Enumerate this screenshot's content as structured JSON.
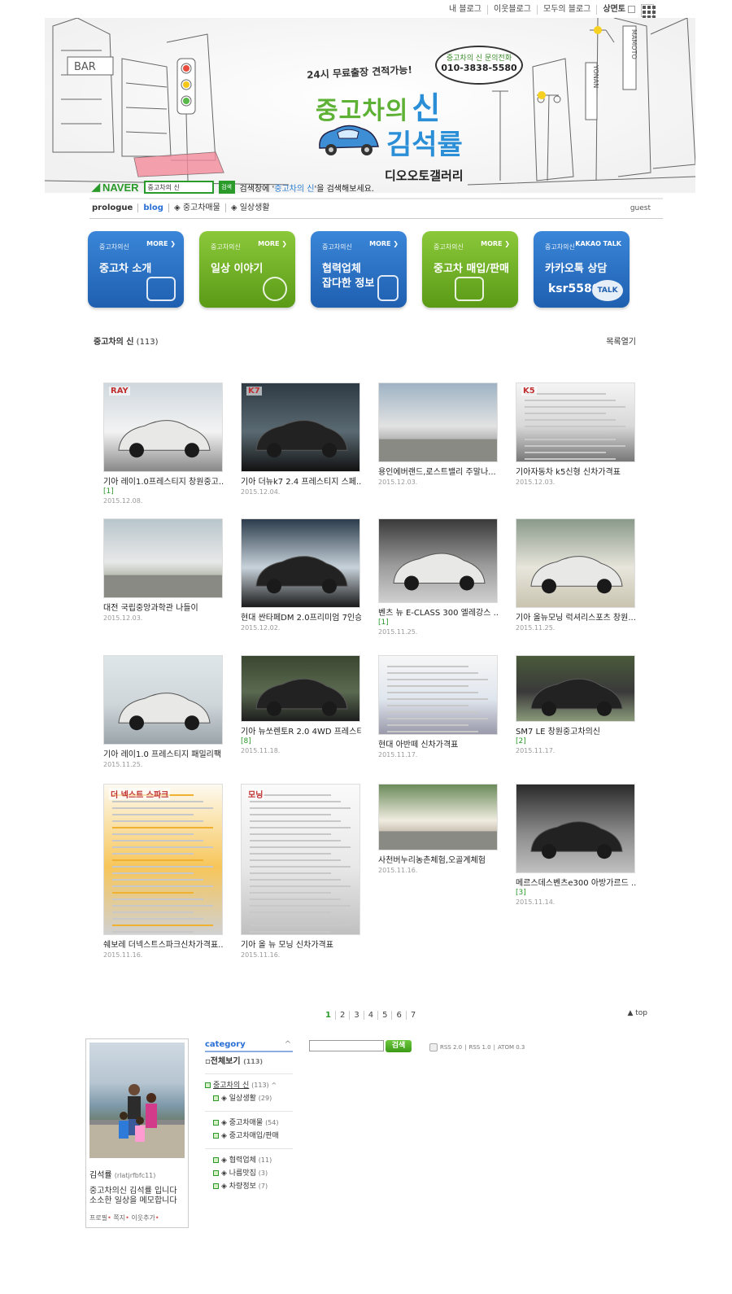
{
  "topbar": {
    "items": [
      "내 블로그",
      "이웃블로그",
      "모두의 블로그",
      "상면토"
    ]
  },
  "header": {
    "slogan": "24시 무료출장 견적가능!",
    "bubble_line1": "중고차의 신 문의전화",
    "bubble_line2": "010-3838-5580",
    "title_part1": "중고차의",
    "title_part2": "신",
    "title_name": "김석률",
    "subtitle": "디오오토갤러리",
    "sign_bar": "BAR",
    "sign_mamoto": "MAMOTO",
    "sign_yonan": "YONAN"
  },
  "search": {
    "brand": "NAVER",
    "value": "중고차의 신",
    "button": "검색",
    "hint_pre": "검색창에 '",
    "hint_key": "중고차의 신",
    "hint_post": "'을 검색해보세요."
  },
  "nav": {
    "items": [
      "prologue",
      "blog",
      "◈ 중고차매물",
      "◈ 일상생활"
    ],
    "guest": "guest"
  },
  "menus": [
    {
      "small": "중고차의신",
      "more": "MORE ❯",
      "label": "중고차 소개"
    },
    {
      "small": "중고차의신",
      "more": "MORE ❯",
      "label": "일상 이야기"
    },
    {
      "small": "중고차의신",
      "more": "MORE ❯",
      "label": "협력업체\n잡다한 정보"
    },
    {
      "small": "중고차의신",
      "more": "MORE ❯",
      "label": "중고차 매입/판매"
    },
    {
      "small": "중고차의신",
      "more": "KAKAO TALK",
      "label": "카카오톡 상담",
      "kakao_id": "ksr5580",
      "talk": "TALK"
    }
  ],
  "list": {
    "title": "중고차의 신",
    "count": "(113)",
    "open": "목록열기"
  },
  "posts": [
    {
      "title": "기아 레이1.0프레스티지 창원중고...",
      "comments": "[1]",
      "date": "2015.12.08.",
      "thumb_text": "RAY"
    },
    {
      "title": "기아 더뉴k7 2.4 프레스티지 스페...",
      "comments": "",
      "date": "2015.12.04.",
      "thumb_text": "K7"
    },
    {
      "title": "용인에버랜드,로스트밸리 주말나...",
      "comments": "",
      "date": "2015.12.03.",
      "thumb_text": ""
    },
    {
      "title": "기아자동차 k5신형 신차가격표",
      "comments": "",
      "date": "2015.12.03.",
      "thumb_text": "K5"
    },
    {
      "title": "대전 국립중앙과학관 나들이",
      "comments": "",
      "date": "2015.12.03.",
      "thumb_text": ""
    },
    {
      "title": "현대 싼타페DM 2.0프리미엄 7인승 ...",
      "comments": "",
      "date": "2015.12.02.",
      "thumb_text": ""
    },
    {
      "title": "벤츠 뉴 E-CLASS 300 엘레강스 ...",
      "comments": "[1]",
      "date": "2015.11.25.",
      "thumb_text": ""
    },
    {
      "title": "기아 올뉴모닝 럭셔리스포츠 창원...",
      "comments": "",
      "date": "2015.11.25.",
      "thumb_text": ""
    },
    {
      "title": "기아 레이1.0 프레스티지 패밀리팩",
      "comments": "",
      "date": "2015.11.25.",
      "thumb_text": ""
    },
    {
      "title": "기아 뉴쏘렌토R 2.0 4WD 프레스티지",
      "comments": "[8]",
      "date": "2015.11.18.",
      "thumb_text": ""
    },
    {
      "title": "현대 아반떼 신차가격표",
      "comments": "",
      "date": "2015.11.17.",
      "thumb_text": ""
    },
    {
      "title": "SM7 LE 창원중고차의신",
      "comments": "[2]",
      "date": "2015.11.17.",
      "thumb_text": ""
    },
    {
      "title": "쉐보레 더넥스트스파크신차가격표...",
      "comments": "",
      "date": "2015.11.16.",
      "thumb_text": "더 넥스트 스파크"
    },
    {
      "title": "기아 올 뉴 모닝 신차가격표",
      "comments": "",
      "date": "2015.11.16.",
      "thumb_text": "모닝"
    },
    {
      "title": "사천버누리농촌체험,오골계체험",
      "comments": "",
      "date": "2015.11.16.",
      "thumb_text": ""
    },
    {
      "title": "메르스데스벤츠e300 아방가르드 ...",
      "comments": "[3]",
      "date": "2015.11.14.",
      "thumb_text": ""
    }
  ],
  "pager": {
    "pages": [
      "1",
      "2",
      "3",
      "4",
      "5",
      "6",
      "7"
    ],
    "top": "▲ top"
  },
  "profile": {
    "name": "김석률",
    "id": "(rlatjrfbfc11)",
    "desc": "중고차의신 김석률 입니다 소소한 일상을 메모합니다",
    "links": [
      "프로필",
      "쪽지",
      "이웃추가"
    ]
  },
  "category": {
    "head": "category",
    "all": "전체보기",
    "all_count": "(113)",
    "items": [
      {
        "label": "중고차의 신",
        "count": "(113)"
      },
      {
        "label": "◈ 일상생활",
        "count": "(29)"
      },
      {
        "label": "◈ 중고차매물",
        "count": "(54)"
      },
      {
        "label": "◈ 중고차매입/판매",
        "count": ""
      },
      {
        "label": "◈ 협력업체",
        "count": "(11)"
      },
      {
        "label": "◈ 나름맛집",
        "count": "(3)"
      },
      {
        "label": "◈ 차량정보",
        "count": "(7)"
      }
    ]
  },
  "blog_search": {
    "button": "검색"
  },
  "rss": {
    "items": [
      "RSS 2.0",
      "RSS 1.0",
      "ATOM 0.3"
    ]
  },
  "colors": {
    "green": "#5db236",
    "blue": "#2b8fd8",
    "naver_green": "#2a9a2a"
  }
}
